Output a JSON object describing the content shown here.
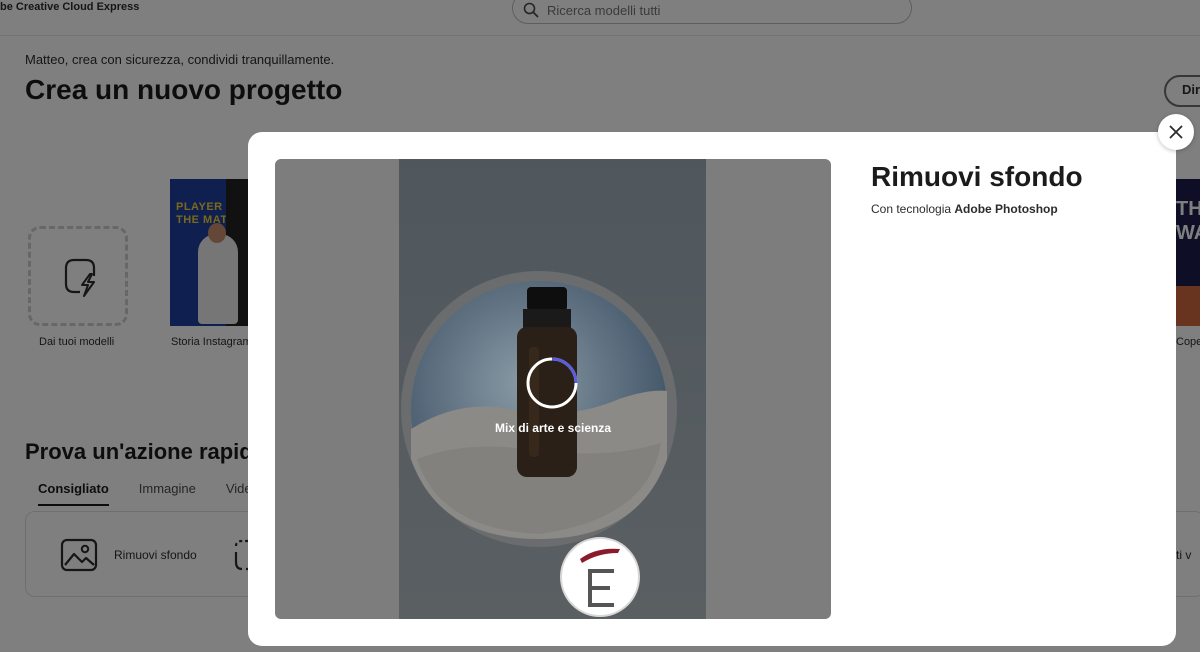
{
  "app": {
    "brand": "be Creative Cloud Express"
  },
  "search": {
    "placeholder": "Ricerca modelli tutti"
  },
  "home": {
    "greeting": "Matteo, crea con sicurezza, condividi tranquillamente.",
    "title": "Crea un nuovo progetto",
    "right_button": "Dir",
    "tiles": [
      {
        "label": "Dai tuoi modelli"
      },
      {
        "label": "Storia Instagram",
        "thumb_title": "PLAYER OF THE MATCH"
      },
      {
        "label": "Cope",
        "thumb_title": "TH WA"
      }
    ],
    "quick_title": "Prova un'azione rapid",
    "tabs": [
      "Consigliato",
      "Immagine",
      "Vide"
    ],
    "quick_actions": [
      {
        "label": "Rimuovi sfondo",
        "icon": "image-icon"
      },
      {
        "label": "",
        "icon": "lasso-icon"
      }
    ],
    "partial_action_label": "rti v"
  },
  "modal": {
    "title": "Rimuovi sfondo",
    "subtitle_prefix": "Con tecnologia",
    "subtitle_brand": "Adobe Photoshop",
    "loading_text": "Mix di arte e scienza",
    "close_icon": "close-icon"
  },
  "colors": {
    "overlay": "rgba(0,0,0,0.5)",
    "spinner_accent": "#5c5ce0",
    "logo_accent": "#8b1a2b"
  }
}
